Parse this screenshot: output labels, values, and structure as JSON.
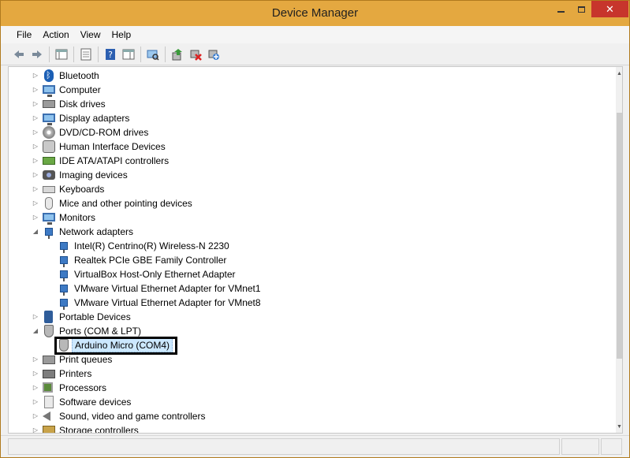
{
  "window": {
    "title": "Device Manager"
  },
  "menu": [
    "File",
    "Action",
    "View",
    "Help"
  ],
  "toolbar": {
    "buttons": [
      {
        "icon": "back-arrow-icon"
      },
      {
        "icon": "forward-arrow-icon"
      },
      {
        "icon": "show-hide-console-tree-icon"
      },
      {
        "icon": "properties-sheet-icon"
      },
      {
        "icon": "help-icon"
      },
      {
        "icon": "action-pane-icon"
      },
      {
        "icon": "scan-hardware-changes-icon"
      },
      {
        "icon": "update-driver-icon"
      },
      {
        "icon": "uninstall-device-icon"
      },
      {
        "icon": "add-legacy-hardware-icon"
      }
    ]
  },
  "tree": {
    "bluetooth": "Bluetooth",
    "computer": "Computer",
    "disk_drives": "Disk drives",
    "display_adapters": "Display adapters",
    "dvd": "DVD/CD-ROM drives",
    "hid": "Human Interface Devices",
    "ide": "IDE ATA/ATAPI controllers",
    "imaging": "Imaging devices",
    "keyboards": "Keyboards",
    "mice": "Mice and other pointing devices",
    "monitors": "Monitors",
    "network": "Network adapters",
    "network_children": [
      "Intel(R) Centrino(R) Wireless-N 2230",
      "Realtek PCIe GBE Family Controller",
      "VirtualBox Host-Only Ethernet Adapter",
      "VMware Virtual Ethernet Adapter for VMnet1",
      "VMware Virtual Ethernet Adapter for VMnet8"
    ],
    "portable": "Portable Devices",
    "ports": "Ports (COM & LPT)",
    "ports_children": [
      "Arduino Micro (COM4)"
    ],
    "print_queues": "Print queues",
    "printers": "Printers",
    "processors": "Processors",
    "software_devices": "Software devices",
    "sound": "Sound, video and game controllers",
    "storage": "Storage controllers"
  },
  "colors": {
    "titlebar": "#e4a840",
    "close_button": "#c7352c",
    "selection": "#cce8ff"
  }
}
